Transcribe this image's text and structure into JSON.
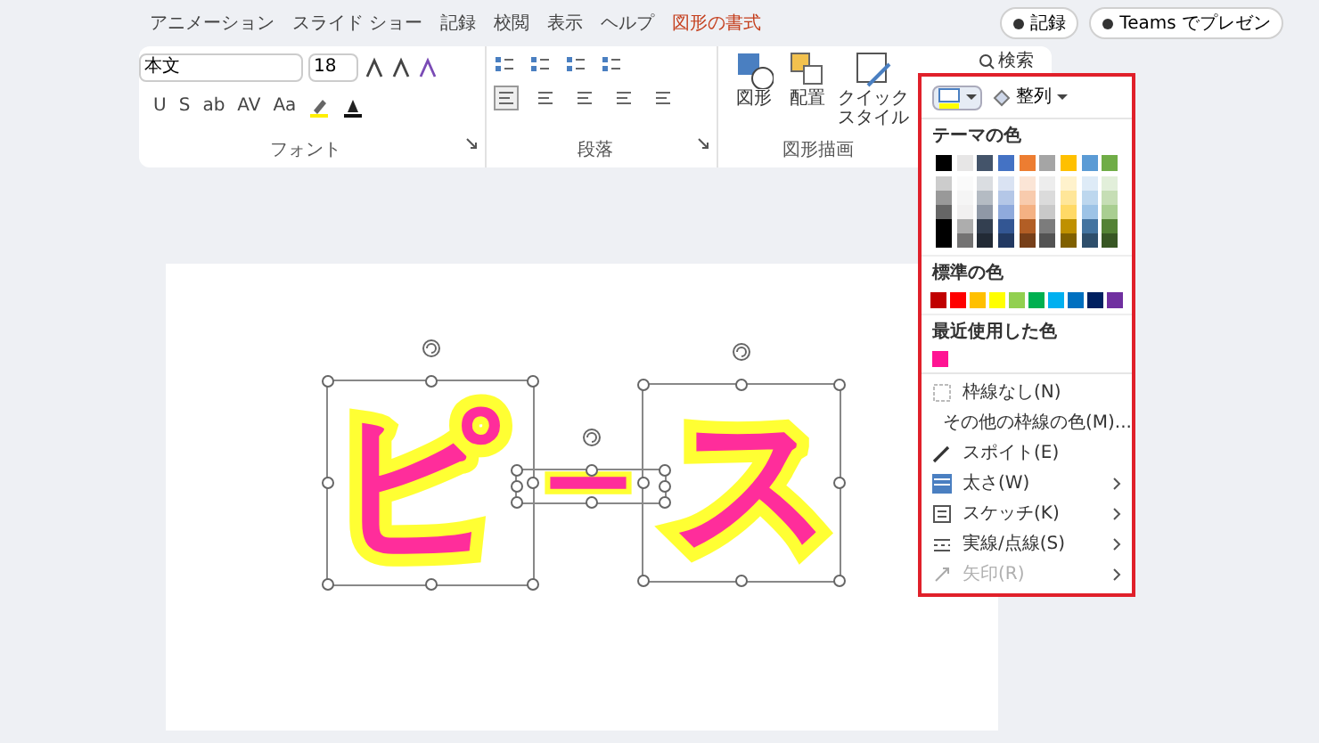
{
  "tabs": [
    {
      "label": "アニメーション",
      "selected": false
    },
    {
      "label": "スライド ショー",
      "selected": false
    },
    {
      "label": "記録",
      "selected": false
    },
    {
      "label": "校閲",
      "selected": false
    },
    {
      "label": "表示",
      "selected": false
    },
    {
      "label": "ヘルプ",
      "selected": false
    },
    {
      "label": "図形の書式",
      "selected": true
    }
  ],
  "top_buttons": [
    {
      "label": "記録"
    },
    {
      "label": "Teams でプレゼン"
    }
  ],
  "font_group": {
    "font_name": "本文",
    "font_size": "18",
    "format_buttons": [
      "U",
      "S",
      "ab",
      "AV",
      "Aa"
    ],
    "label": "フォント"
  },
  "paragraph_group": {
    "label": "段落"
  },
  "drawing_group": {
    "buttons": [
      "図形",
      "配置",
      "クイックスタイル"
    ],
    "search": "検索",
    "label": "図形描画"
  },
  "outline_menu": {
    "fill_button": "整列",
    "theme_colors_title": "テーマの色",
    "theme_colors": [
      {
        "color": "#000000"
      },
      {
        "color": "#e7e6e6"
      },
      {
        "color": "#44546a"
      },
      {
        "color": "#4472c4"
      },
      {
        "color": "#ed7d31"
      },
      {
        "color": "#a5a5a5"
      },
      {
        "color": "#ffc000"
      },
      {
        "color": "#5b9bd5"
      },
      {
        "color": "#70ad47"
      }
    ],
    "standard_colors_title": "標準の色",
    "standard_colors": [
      {
        "color": "#c00000"
      },
      {
        "color": "#ff0000"
      },
      {
        "color": "#ffc000"
      },
      {
        "color": "#ffff00"
      },
      {
        "color": "#92d050"
      },
      {
        "color": "#00b050"
      },
      {
        "color": "#00b0f0"
      },
      {
        "color": "#0070c0"
      },
      {
        "color": "#002060"
      },
      {
        "color": "#7030a0"
      }
    ],
    "recent_colors_title": "最近使用した色",
    "recent_colors": [
      {
        "color": "#ff1493"
      }
    ],
    "items": [
      {
        "kind": "none",
        "label": "枠線なし(N)",
        "submenu": false,
        "disabled": false
      },
      {
        "kind": "more",
        "label": "その他の枠線の色(M)...",
        "submenu": false,
        "disabled": false
      },
      {
        "kind": "eyedropper",
        "label": "スポイト(E)",
        "submenu": false,
        "disabled": false
      },
      {
        "kind": "weight",
        "label": "太さ(W)",
        "submenu": true,
        "disabled": false
      },
      {
        "kind": "sketch",
        "label": "スケッチ(K)",
        "submenu": true,
        "disabled": false
      },
      {
        "kind": "dash",
        "label": "実線/点線(S)",
        "submenu": true,
        "disabled": false
      },
      {
        "kind": "arrow",
        "label": "矢印(R)",
        "submenu": true,
        "disabled": true
      }
    ]
  },
  "slide": {
    "shapes": [
      {
        "text": "ピ",
        "selected": true
      },
      {
        "text": "ー",
        "selected": true
      },
      {
        "text": "ス",
        "selected": true
      }
    ]
  }
}
